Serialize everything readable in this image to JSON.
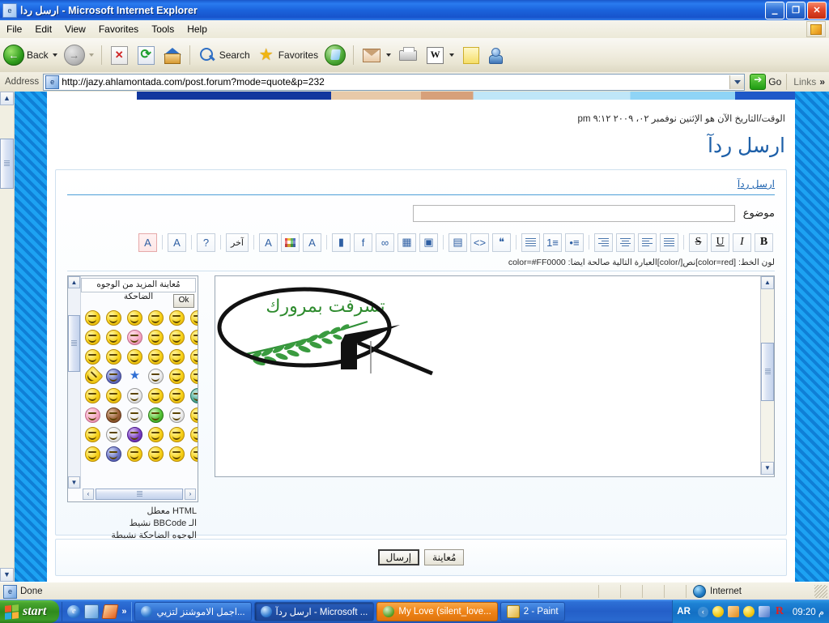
{
  "window": {
    "title": "ارسل ردا - Microsoft Internet Explorer",
    "icon": "ie-document-icon",
    "minimize": "–",
    "restore": "❐",
    "close": "✕"
  },
  "menubar": {
    "items": [
      {
        "label": "File"
      },
      {
        "label": "Edit"
      },
      {
        "label": "View"
      },
      {
        "label": "Favorites"
      },
      {
        "label": "Tools"
      },
      {
        "label": "Help"
      }
    ]
  },
  "toolbar": {
    "back_label": "Back",
    "search_label": "Search",
    "favorites_label": "Favorites"
  },
  "addressbar": {
    "label": "Address",
    "url": "http://jazy.ahlamontada.com/post.forum?mode=quote&p=232",
    "go_label": "Go",
    "links_label": "Links",
    "chevron": "»"
  },
  "page": {
    "datetime": "الوقت/التاريخ الآن هو الإثنين نوفمبر ٠٢، ٢٠٠٩ ٩:١٢ pm",
    "heading": "ارسل ردآ",
    "panel_link": "ارسل ردآ",
    "subject_label": "موضوع",
    "subject_value": "",
    "color_help": "لون الخط: [color=red]نص[/color]العبارة التالية صالحة ايضا: color=#FF0000",
    "editor": {
      "buttons": [
        {
          "name": "bold-button",
          "glyph": "B"
        },
        {
          "name": "italic-button",
          "glyph": "I"
        },
        {
          "name": "underline-button",
          "glyph": "U"
        },
        {
          "name": "strikethrough-button",
          "glyph": "S"
        },
        {
          "name": "align-justify-button",
          "glyph": "≡"
        },
        {
          "name": "align-left-button",
          "glyph": "≡"
        },
        {
          "name": "align-center-button",
          "glyph": "≡"
        },
        {
          "name": "align-right-button",
          "glyph": "≡"
        },
        {
          "name": "bulleted-list-button",
          "glyph": "•≡"
        },
        {
          "name": "numbered-list-button",
          "glyph": "1≡"
        },
        {
          "name": "indent-button",
          "glyph": "≡"
        },
        {
          "name": "quote-button",
          "glyph": "❝"
        },
        {
          "name": "code-button",
          "glyph": "<>"
        },
        {
          "name": "table-button",
          "glyph": "▤"
        },
        {
          "name": "insert-image-saved-button",
          "glyph": "▣"
        },
        {
          "name": "insert-image-button",
          "glyph": "▦"
        },
        {
          "name": "insert-link-button",
          "glyph": "∞"
        },
        {
          "name": "insert-flash-button",
          "glyph": "f"
        },
        {
          "name": "insert-video-button",
          "glyph": "▮"
        },
        {
          "name": "font-face-button",
          "glyph": "A"
        },
        {
          "name": "font-color-button",
          "glyph": "▩"
        },
        {
          "name": "font-size-button",
          "glyph": "A"
        },
        {
          "name": "other-button",
          "glyph": "آخر"
        },
        {
          "name": "help-button",
          "glyph": "?"
        },
        {
          "name": "font-style-button",
          "glyph": "A"
        },
        {
          "name": "text-format-button",
          "glyph": "A"
        }
      ]
    },
    "smilies": {
      "header": "مُعاينة المزيد من الوجوه الضاحكة",
      "ok_label": "Ok",
      "rows": [
        [
          "yellow",
          "yellow",
          "yellow",
          "yellow",
          "yellow",
          "yellow"
        ],
        [
          "yellow",
          "yellow",
          "pink",
          "yellow",
          "yellow",
          "yellow"
        ],
        [
          "yellow",
          "yellow",
          "yellow",
          "yellow",
          "yellow",
          "yellow"
        ],
        [
          "heart",
          "blue",
          "star",
          "white",
          "yellow",
          "yellow"
        ],
        [
          "yellow",
          "yellow",
          "white",
          "yellow",
          "yellow",
          "teal"
        ],
        [
          "pink",
          "brown",
          "white",
          "green",
          "white",
          "yellow"
        ],
        [
          "yellow",
          "white",
          "purple",
          "yellow",
          "yellow",
          "yellow"
        ],
        [
          "yellow",
          "blue",
          "yellow",
          "yellow",
          "yellow",
          "yellow"
        ]
      ],
      "scroll_left": "‹",
      "scroll_right": "›",
      "scroll_up": "▲",
      "scroll_down": "▼"
    },
    "status_lines": [
      "HTML معطل",
      "الـ BBCode نشيط",
      "الوجوه الضاحكة نشيطة"
    ],
    "content_text": "تشرفت بمرورك",
    "buttons": {
      "submit": "إرسال",
      "preview": "مُعاينة"
    }
  },
  "statusbar": {
    "text": "Done",
    "zone": "Internet",
    "zone_icon": "globe-icon"
  },
  "taskbar": {
    "start_label": "start",
    "quicklaunch_chevron": "»",
    "tasks": [
      {
        "label": "اجمل الاموشنز لتزيي...",
        "icon": "ie-icon",
        "state": "normal"
      },
      {
        "label": "ارسل ردآ - Microsoft ...",
        "icon": "ie-icon",
        "state": "active"
      },
      {
        "label": "My Love (silent_love...",
        "icon": "msn-icon",
        "state": "msn"
      },
      {
        "label": "2 - Paint",
        "icon": "paint-icon",
        "state": "normal"
      }
    ],
    "language": "AR",
    "clock": "09:20 م",
    "tray_chevron": "‹"
  },
  "colors": {
    "titlebar_blue": "#1f68de",
    "page_stripe_blue": "#1da2f2",
    "heading_blue": "#1d5fa8",
    "link_blue": "#1f64b0",
    "art_green": "#2e8b2e",
    "start_green": "#3d9b27"
  }
}
